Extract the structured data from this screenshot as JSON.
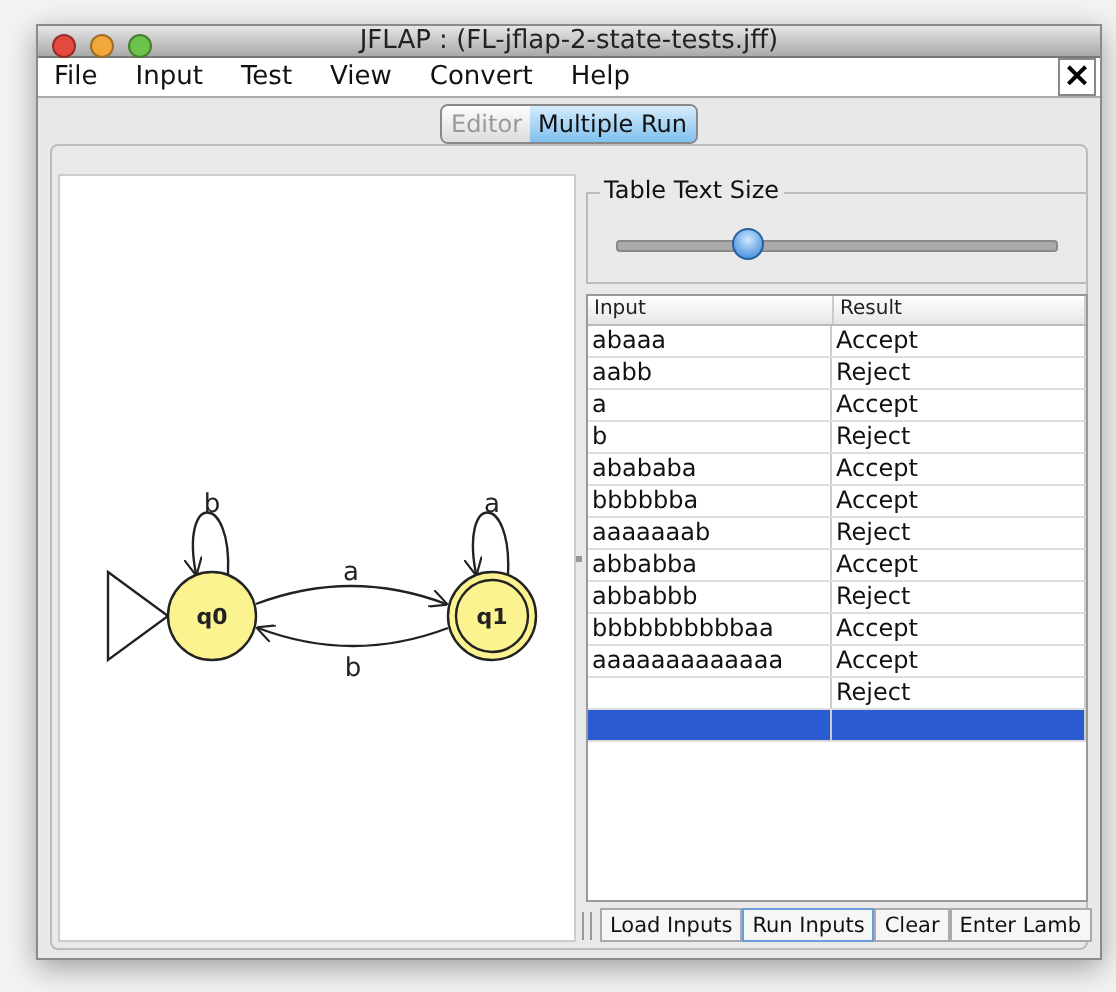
{
  "window": {
    "title": "JFLAP : (FL-jflap-2-state-tests.jff)"
  },
  "menu": [
    "File",
    "Input",
    "Test",
    "View",
    "Convert",
    "Help"
  ],
  "close_button": "×",
  "tabs": [
    {
      "label": "Editor",
      "selected": false
    },
    {
      "label": "Multiple Run",
      "selected": true
    }
  ],
  "automaton": {
    "states": [
      {
        "label": "q0",
        "initial": true,
        "final": false,
        "transitions": [
          {
            "kind": "loop",
            "label": "b"
          },
          {
            "kind": "arc",
            "label": "a"
          }
        ]
      },
      {
        "label": "q1",
        "initial": false,
        "final": true,
        "transitions": [
          {
            "kind": "loop",
            "label": "a"
          },
          {
            "kind": "arc",
            "label": "b"
          }
        ]
      }
    ]
  },
  "text_size": {
    "title": "Table Text Size",
    "level": 0.3
  },
  "table": {
    "columns": [
      "Input",
      "Result"
    ],
    "rows": [
      {
        "input": "abaaa",
        "result": "Accept",
        "selected": false
      },
      {
        "input": "aabb",
        "result": "Reject",
        "selected": false
      },
      {
        "input": "a",
        "result": "Accept",
        "selected": false
      },
      {
        "input": "b",
        "result": "Reject",
        "selected": false
      },
      {
        "input": "abababa",
        "result": "Accept",
        "selected": false
      },
      {
        "input": "bbbbbba",
        "result": "Accept",
        "selected": false
      },
      {
        "input": "aaaaaaab",
        "result": "Reject",
        "selected": false
      },
      {
        "input": "abbabba",
        "result": "Accept",
        "selected": false
      },
      {
        "input": "abbabbb",
        "result": "Reject",
        "selected": false
      },
      {
        "input": "bbbbbbbbbbaa",
        "result": "Accept",
        "selected": false
      },
      {
        "input": "aaaaaaaaaaaaa",
        "result": "Accept",
        "selected": false
      },
      {
        "result": "Reject",
        "selected": false
      },
      {
        "selected": true
      }
    ]
  },
  "buttons": [
    {
      "label": "Load Inputs",
      "focused": false
    },
    {
      "label": "Run Inputs",
      "focused": true
    },
    {
      "label": "Clear",
      "focused": false
    },
    {
      "label": "Enter Lamb",
      "focused": false
    }
  ]
}
